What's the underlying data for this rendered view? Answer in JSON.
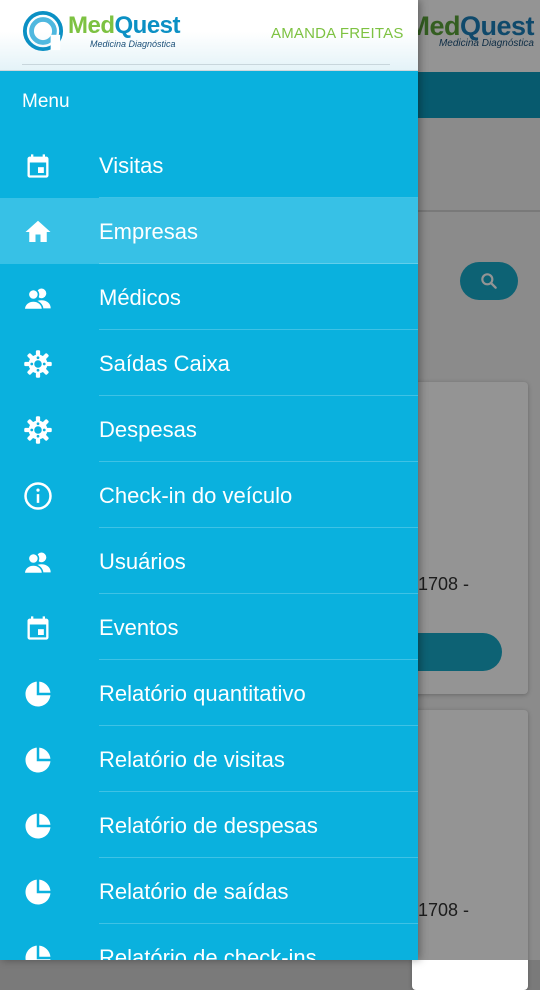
{
  "brand": {
    "name_part1": "Med",
    "name_part2": "Quest",
    "tagline": "Medicina Diagnóstica"
  },
  "user": {
    "name": "AMANDA FREITAS"
  },
  "menu": {
    "title": "Menu",
    "active_index": 1,
    "items": [
      {
        "label": "Visitas",
        "icon": "calendar-icon"
      },
      {
        "label": "Empresas",
        "icon": "home-icon"
      },
      {
        "label": "Médicos",
        "icon": "people-icon"
      },
      {
        "label": "Saídas Caixa",
        "icon": "gear-icon"
      },
      {
        "label": "Despesas",
        "icon": "gear-icon"
      },
      {
        "label": "Check-in do veículo",
        "icon": "info-icon"
      },
      {
        "label": "Usuários",
        "icon": "people-icon"
      },
      {
        "label": "Eventos",
        "icon": "calendar-icon"
      },
      {
        "label": "Relatório quantitativo",
        "icon": "pie-chart-icon"
      },
      {
        "label": "Relatório de visitas",
        "icon": "pie-chart-icon"
      },
      {
        "label": "Relatório de despesas",
        "icon": "pie-chart-icon"
      },
      {
        "label": "Relatório de saídas",
        "icon": "pie-chart-icon"
      },
      {
        "label": "Relatório de check-ins",
        "icon": "pie-chart-icon"
      }
    ]
  },
  "background": {
    "card1_text": "1708 -",
    "card2_text": "1708 -"
  },
  "colors": {
    "drawer": "#0ab1de",
    "active_item": "#37c1e6",
    "brand_green": "#7dc242",
    "brand_blue": "#0b90c4"
  }
}
